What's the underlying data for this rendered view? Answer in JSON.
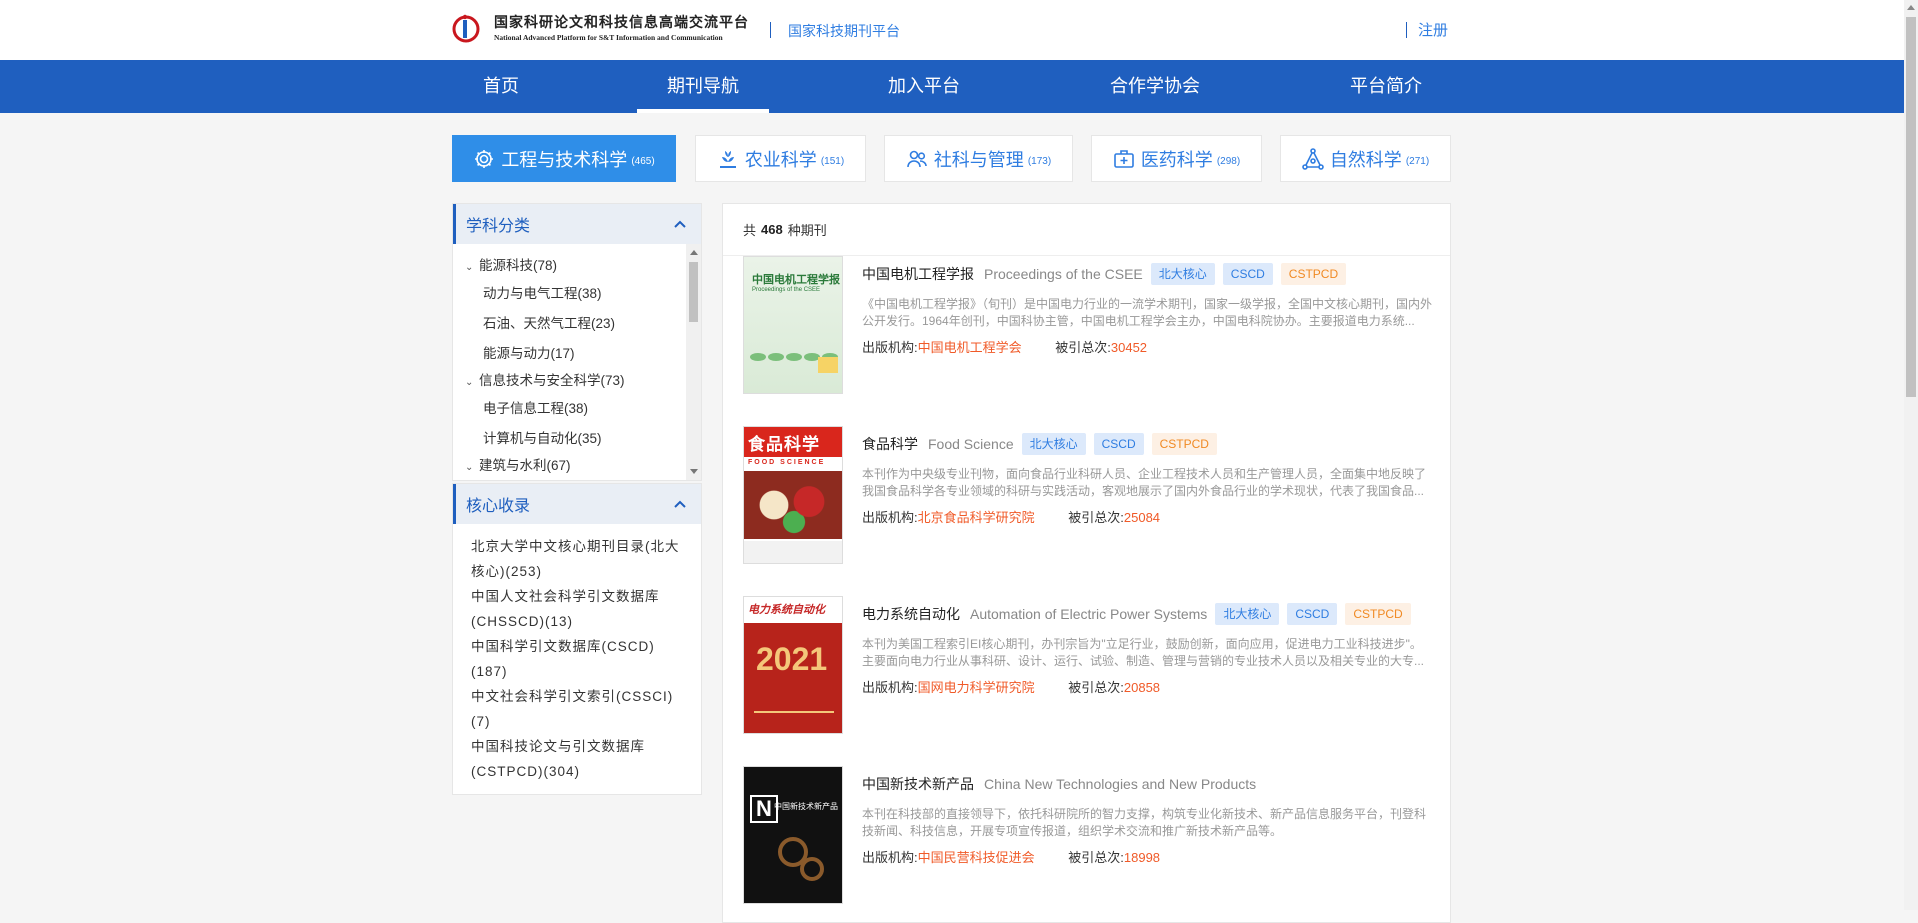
{
  "header": {
    "logo_cn": "国家科研论文和科技信息高端交流平台",
    "logo_en": "National Advanced Platform for S&T Information and Communication",
    "logo_mark": "ISTIC",
    "platform_link": "国家科技期刊平台",
    "register": "注册"
  },
  "nav": {
    "items": [
      {
        "label": "首页"
      },
      {
        "label": "期刊导航",
        "active": true
      },
      {
        "label": "加入平台"
      },
      {
        "label": "合作学协会"
      },
      {
        "label": "平台简介"
      }
    ]
  },
  "categories": [
    {
      "label": "工程与技术科学",
      "count": "(465)",
      "icon": "gear-icon",
      "active": true
    },
    {
      "label": "农业科学",
      "count": "(151)",
      "icon": "wheat-icon"
    },
    {
      "label": "社科与管理",
      "count": "(173)",
      "icon": "people-icon"
    },
    {
      "label": "医药科学",
      "count": "(298)",
      "icon": "medical-kit-icon"
    },
    {
      "label": "自然科学",
      "count": "(271)",
      "icon": "molecule-icon"
    }
  ],
  "subjects": {
    "title": "学科分类",
    "items": [
      {
        "label": "能源科技(78)",
        "level": "parent"
      },
      {
        "label": "动力与电气工程(38)",
        "level": "child"
      },
      {
        "label": "石油、天然气工程(23)",
        "level": "child"
      },
      {
        "label": "能源与动力(17)",
        "level": "child"
      },
      {
        "label": "信息技术与安全科学(73)",
        "level": "parent"
      },
      {
        "label": "电子信息工程(38)",
        "level": "child"
      },
      {
        "label": "计算机与自动化(35)",
        "level": "child"
      },
      {
        "label": "建筑与水利(67)",
        "level": "parent"
      }
    ]
  },
  "core": {
    "title": "核心收录",
    "items": [
      {
        "label": "北京大学中文核心期刊目录(北大核心)(253)"
      },
      {
        "label": "中国人文社会科学引文数据库(CHSSCD)(13)"
      },
      {
        "label": "中国科学引文数据库(CSCD)(187)"
      },
      {
        "label": "中文社会科学引文索引(CSSCI)(7)"
      },
      {
        "label": "中国科技论文与引文数据库(CSTPCD)(304)"
      }
    ]
  },
  "list": {
    "prefix": "共",
    "total": "468",
    "suffix": "种期刊",
    "publisher_label": "出版机构:",
    "cite_label": "被引总次:",
    "journals": [
      {
        "title": "中国电机工程学报",
        "en": "Proceedings of the CSEE",
        "tags": [
          "北大核心",
          "CSCD",
          "CSTPCD"
        ],
        "desc": "《中国电机工程学报》（旬刊）是中国电力行业的一流学术期刊，国家一级学报，全国中文核心期刊，国内外公开发行。1964年创刊，中国科协主管，中国电机工程学会主办，中国电科院协办。主要报道电力系统...",
        "publisher": "中国电机工程学会",
        "cites": "30452",
        "cover_title": "中国电机工程学报",
        "cover_sub": "Proceedings of the CSEE"
      },
      {
        "title": "食品科学",
        "en": "Food Science",
        "tags": [
          "北大核心",
          "CSCD",
          "CSTPCD"
        ],
        "desc": "本刊作为中央级专业刊物，面向食品行业科研人员、企业工程技术人员和生产管理人员，全面集中地反映了我国食品科学各专业领域的科研与实践活动，客观地展示了国内外食品行业的学术现状，代表了我国食品...",
        "publisher": "北京食品科学研究院",
        "cites": "25084",
        "cover_title": "食品科学",
        "cover_sub": "FOOD SCIENCE"
      },
      {
        "title": "电力系统自动化",
        "en": "Automation of Electric Power Systems",
        "tags": [
          "北大核心",
          "CSCD",
          "CSTPCD"
        ],
        "desc": "本刊为美国工程索引EI核心期刊，办刊宗旨为\"立足行业，鼓励创新，面向应用，促进电力工业科技进步\"。主要面向电力行业从事科研、设计、运行、试验、制造、管理与营销的专业技术人员以及相关专业的大专...",
        "publisher": "国网电力科学研究院",
        "cites": "20858",
        "cover_title": "电力系统自动化",
        "cover_sub": "2021"
      },
      {
        "title": "中国新技术新产品",
        "en": "China New Technologies and New Products",
        "tags": [],
        "desc": "本刊在科技部的直接领导下，依托科研院所的智力支撑，构筑专业化新技术、新产品信息服务平台，刊登科技新闻、科技信息，开展专项宣传报道，组织学术交流和推广新技术新产品等。",
        "publisher": "中国民营科技促进会",
        "cites": "18998",
        "cover_title": "中国新技术新产品",
        "cover_sub": "N"
      }
    ]
  },
  "colors": {
    "nav_bg": "#1f5fbf",
    "accent": "#2f7de1",
    "active_tab": "#2f8ee8",
    "highlight": "#f05a28"
  }
}
